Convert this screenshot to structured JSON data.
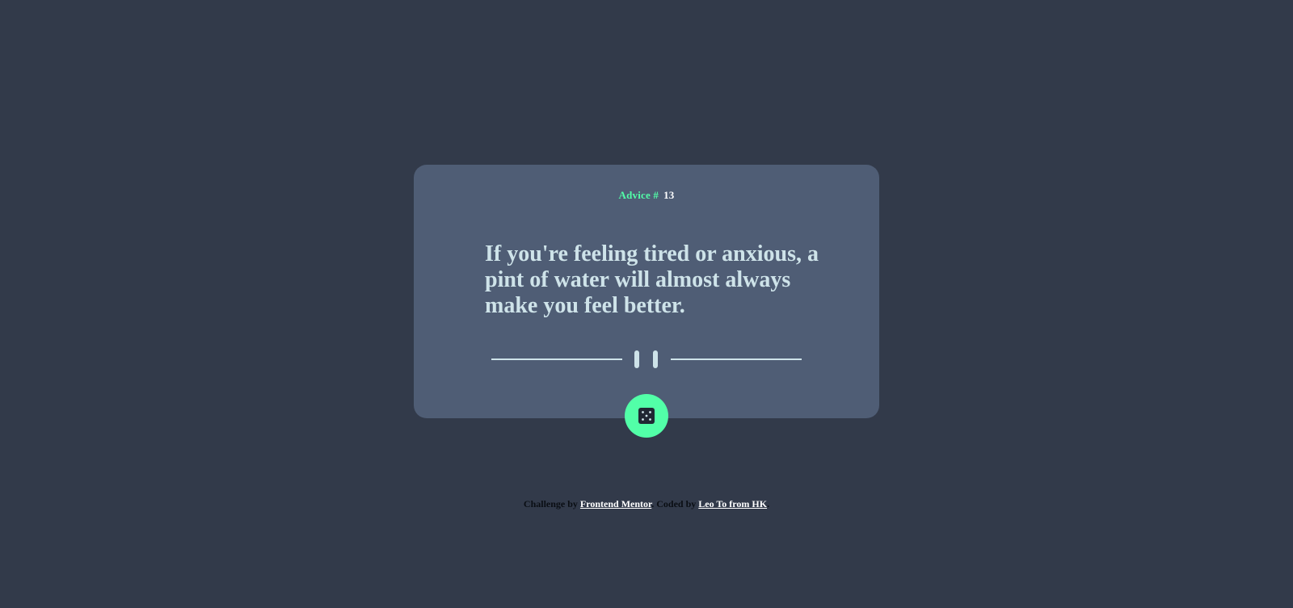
{
  "card": {
    "advice_label": "Advice #",
    "advice_id": "13",
    "quote": "If you're feeling tired or anxious, a pint of water will almost always make you feel better."
  },
  "icons": {
    "divider": "pause-divider-icon",
    "dice": "dice-icon"
  },
  "colors": {
    "background": "#323a4a",
    "card": "#4f5d75",
    "accent": "#52ffa8",
    "text": "#cee3e9"
  },
  "footer": {
    "challenge_text": "Challenge by",
    "challenge_link": "Frontend Mentor",
    "coded_text": "Coded by",
    "coded_link": "Leo To from HK"
  }
}
